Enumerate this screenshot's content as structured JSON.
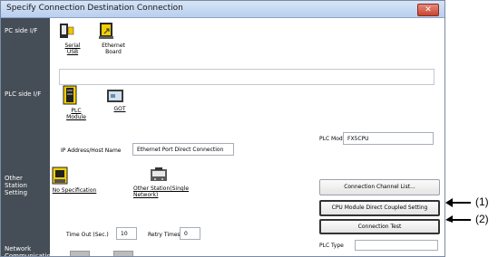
{
  "window": {
    "title": "Specify Connection Destination Connection",
    "close_symbol": "✕"
  },
  "sections": {
    "pc_side": "PC side I/F",
    "plc_side": "PLC side I/F",
    "other_station": "Other\nStation\nSetting",
    "network_communication": "Network\nCommunication"
  },
  "pc_side_items": [
    {
      "label": "Serial\nUSB",
      "icon": "serial-usb-icon"
    },
    {
      "label": "Ethernet\nBoard",
      "icon": "ethernet-board-icon"
    }
  ],
  "plc_side_items": [
    {
      "label": "PLC\nModule",
      "icon": "plc-module-icon"
    },
    {
      "label": "GOT",
      "icon": "got-icon"
    }
  ],
  "plc_mode": {
    "label": "PLC Mode",
    "value": "FX5CPU"
  },
  "ip_address": {
    "label": "IP Address/Host Name",
    "value": "Ethernet Port Direct Connection"
  },
  "other_station_items": [
    {
      "label": "No Specification",
      "icon": "no-specification-icon"
    },
    {
      "label": "Other Station(Single\nNetwork)",
      "icon": "other-station-icon"
    }
  ],
  "buttons": {
    "connection_channel_list": "Connection Channel List...",
    "cpu_direct": "CPU Module Direct Coupled Setting",
    "connection_test": "Connection Test"
  },
  "timeout": {
    "label": "Time Out (Sec.)",
    "value": "10"
  },
  "retry": {
    "label": "Retry Times",
    "value": "0"
  },
  "plc_type": {
    "label": "PLC Type",
    "value": ""
  },
  "annotations": [
    "(1)",
    "(2)"
  ]
}
